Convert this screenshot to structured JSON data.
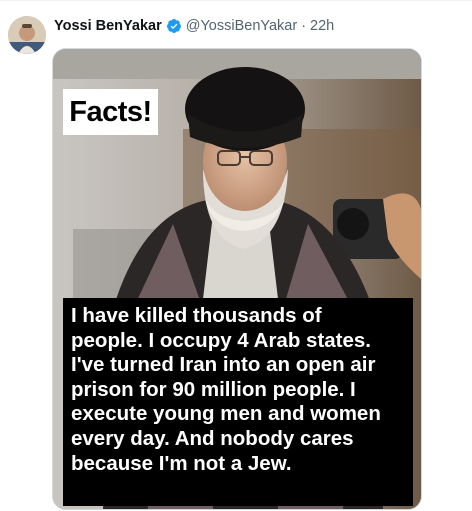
{
  "tweet": {
    "author_name": "Yossi BenYakar",
    "handle": "@YossiBenYakar",
    "separator": "·",
    "time": "22h",
    "verified": true
  },
  "media": {
    "label": "Facts!",
    "caption_lines": [
      "I have killed thousands of",
      "people. I occupy 4 Arab states.",
      "I've turned Iran into an open air",
      "prison for 90 million people. I",
      "execute young men and women",
      "every day. And nobody cares",
      "because I'm not a Jew."
    ]
  },
  "colors": {
    "verified_badge": "#1d9bf0",
    "muted_text": "#536471",
    "primary_text": "#0f1419"
  }
}
